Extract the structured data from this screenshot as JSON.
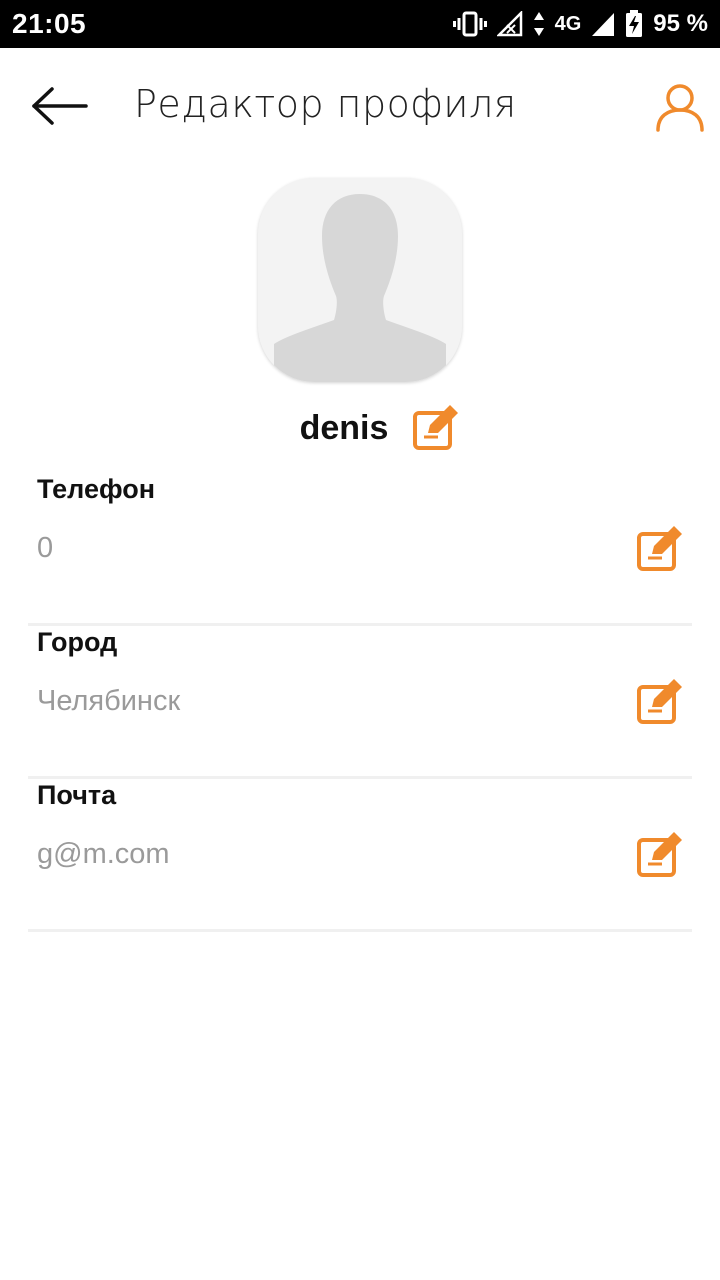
{
  "status_bar": {
    "time": "21:05",
    "network": "4G",
    "battery": "95 %"
  },
  "app_bar": {
    "title": "Редактор профиля",
    "back_icon": "arrow-left-icon",
    "profile_icon": "person-icon"
  },
  "profile": {
    "avatar_icon": "avatar-silhouette",
    "username": "denis"
  },
  "fields": [
    {
      "label": "Телефон",
      "value": "0"
    },
    {
      "label": "Город",
      "value": "Челябинск"
    },
    {
      "label": "Почта",
      "value": "g@m.com"
    }
  ],
  "colors": {
    "accent": "#F08A2C",
    "text_primary": "#111111",
    "text_secondary": "#9A9A9A",
    "divider": "#F0F0F0",
    "status_bar": "#000000"
  }
}
